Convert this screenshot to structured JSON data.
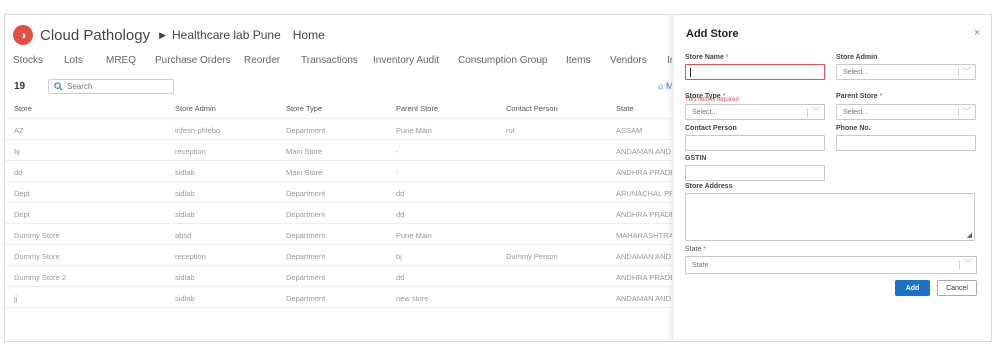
{
  "header": {
    "brand": "Cloud Pathology",
    "lab": "Healthcare lab Pune",
    "home": "Home"
  },
  "nav": [
    "Stocks",
    "Lots",
    "MREQ",
    "Purchase Orders",
    "Reorder",
    "Transactions",
    "Inventory Audit",
    "Consumption Group",
    "Items",
    "Vendors",
    "In"
  ],
  "toolbar": {
    "count": "19",
    "search_placeholder": "Search",
    "action_partial": "M"
  },
  "table": {
    "columns": [
      "Store",
      "Store Admin",
      "Store Type",
      "Parent Store",
      "Contact Person",
      "State"
    ],
    "rows": [
      [
        "AZ",
        "infesn-phlebo",
        "Department",
        "Pune Main",
        "rut",
        "ASSAM"
      ],
      [
        "bj",
        "reception",
        "Main Store",
        "-",
        "",
        "ANDAMAN AND N"
      ],
      [
        "dd",
        "sidlab",
        "Main Store",
        "-",
        "",
        "ANDHRA PRADESH"
      ],
      [
        "Dept",
        "sidlab",
        "Department",
        "dd",
        "",
        "ARUNACHAL PRAD"
      ],
      [
        "Dept",
        "sidlab",
        "Department",
        "dd",
        "",
        "ANDHRA PRADESH"
      ],
      [
        "Dummy Store",
        "absd",
        "Department",
        "Pune Main",
        "",
        "MAHARASHTRA"
      ],
      [
        "Dummy Store",
        "reception",
        "Department",
        "bj",
        "Dummy Person",
        "ANDAMAN AND N"
      ],
      [
        "Dummy Store 2",
        "sidlab",
        "Department",
        "dd",
        "",
        "ANDHRA PRADESH"
      ],
      [
        "jj",
        "sidlab",
        "Department",
        "new store",
        "",
        "ANDAMAN AND N"
      ]
    ]
  },
  "modal": {
    "title": "Add Store",
    "close": "×",
    "store_name_label": "Store Name",
    "store_admin_label": "Store Admin",
    "store_admin_placeholder": "Select...",
    "error_text": "This field is required",
    "store_type_label": "Store Type",
    "store_type_placeholder": "Select...",
    "parent_store_label": "Parent Store",
    "parent_store_placeholder": "Select...",
    "contact_person_label": "Contact Person",
    "phone_label": "Phone No.",
    "gstin_label": "GSTIN",
    "address_label": "Store Address",
    "state_label": "State",
    "state_placeholder": "State",
    "required_mark": "*",
    "add_label": "Add",
    "cancel_label": "Cancel"
  },
  "colors": {
    "brand_logo": "#e4503f",
    "primary_button": "#1a73c8",
    "error": "#d9534f"
  }
}
